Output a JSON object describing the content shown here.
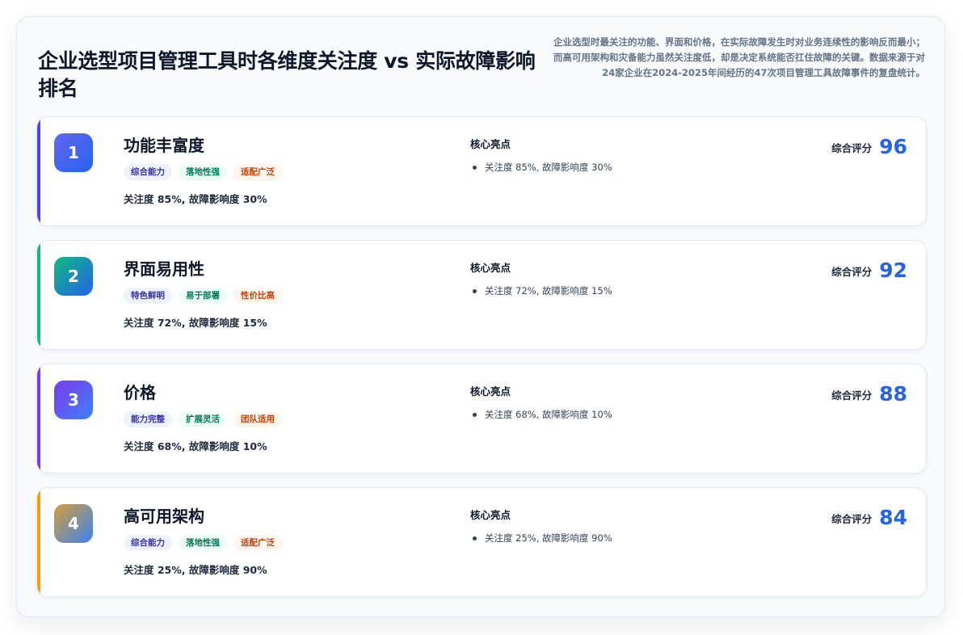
{
  "header": {
    "title": "企业选型项目管理工具时各维度关注度 vs 实际故障影响排名",
    "description": "企业选型时最关注的功能、界面和价格，在实际故障发生时对业务连续性的影响反而最小；而高可用架构和灾备能力虽然关注度低，却是决定系统能否扛住故障的关键。数据来源于对24家企业在2024-2025年间经历的47次项目管理工具故障事件的复盘统计。"
  },
  "labels": {
    "highlights_heading": "核心亮点",
    "score_label": "综合评分"
  },
  "colors": {
    "accent_1": "#4f46e5",
    "accent_2": "#10b981",
    "accent_3": "#7c3aed",
    "accent_4": "#f59e0b",
    "score": "#2563eb"
  },
  "cards": [
    {
      "rank": "1",
      "title": "功能丰富度",
      "tags": [
        "综合能力",
        "落地性强",
        "适配广泛"
      ],
      "stat": "关注度 85%, 故障影响度 30%",
      "highlights": [
        "关注度 85%, 故障影响度 30%"
      ],
      "score": "96"
    },
    {
      "rank": "2",
      "title": "界面易用性",
      "tags": [
        "特色鲜明",
        "易于部署",
        "性价比高"
      ],
      "stat": "关注度 72%, 故障影响度 15%",
      "highlights": [
        "关注度 72%, 故障影响度 15%"
      ],
      "score": "92"
    },
    {
      "rank": "3",
      "title": "价格",
      "tags": [
        "能力完整",
        "扩展灵活",
        "团队适用"
      ],
      "stat": "关注度 68%, 故障影响度 10%",
      "highlights": [
        "关注度 68%, 故障影响度 10%"
      ],
      "score": "88"
    },
    {
      "rank": "4",
      "title": "高可用架构",
      "tags": [
        "综合能力",
        "落地性强",
        "适配广泛"
      ],
      "stat": "关注度 25%, 故障影响度 90%",
      "highlights": [
        "关注度 25%, 故障影响度 90%"
      ],
      "score": "84"
    }
  ]
}
